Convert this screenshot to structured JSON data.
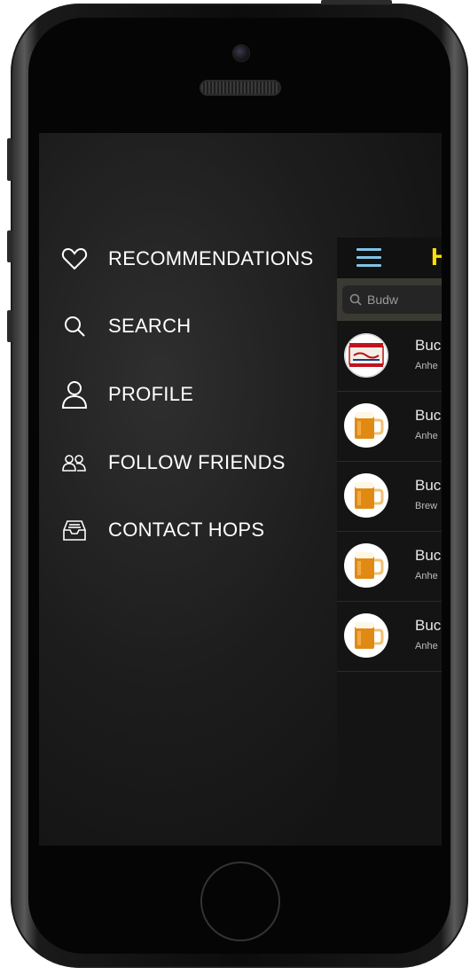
{
  "menu": {
    "items": [
      {
        "label": "RECOMMENDATIONS",
        "icon": "heart-icon"
      },
      {
        "label": "SEARCH",
        "icon": "search-icon"
      },
      {
        "label": "PROFILE",
        "icon": "user-icon"
      },
      {
        "label": "FOLLOW FRIENDS",
        "icon": "users-icon"
      },
      {
        "label": "CONTACT HOPS",
        "icon": "inbox-icon"
      }
    ]
  },
  "app": {
    "title": "H",
    "search": {
      "value": "Budw"
    },
    "results": [
      {
        "name": "Buc",
        "brewery": "Anhe",
        "thumb": "budweiser-label"
      },
      {
        "name": "Buc",
        "brewery": "Anhe",
        "thumb": "beer-mug"
      },
      {
        "name": "Buc",
        "brewery": "Brew",
        "thumb": "beer-mug"
      },
      {
        "name": "Buc",
        "brewery": "Anhe",
        "thumb": "beer-mug"
      },
      {
        "name": "Buc",
        "brewery": "Anhe",
        "thumb": "beer-mug"
      }
    ]
  },
  "colors": {
    "accent": "#ffe000",
    "hamburger": "#7fc4e6",
    "menu_text": "#ffffff"
  }
}
